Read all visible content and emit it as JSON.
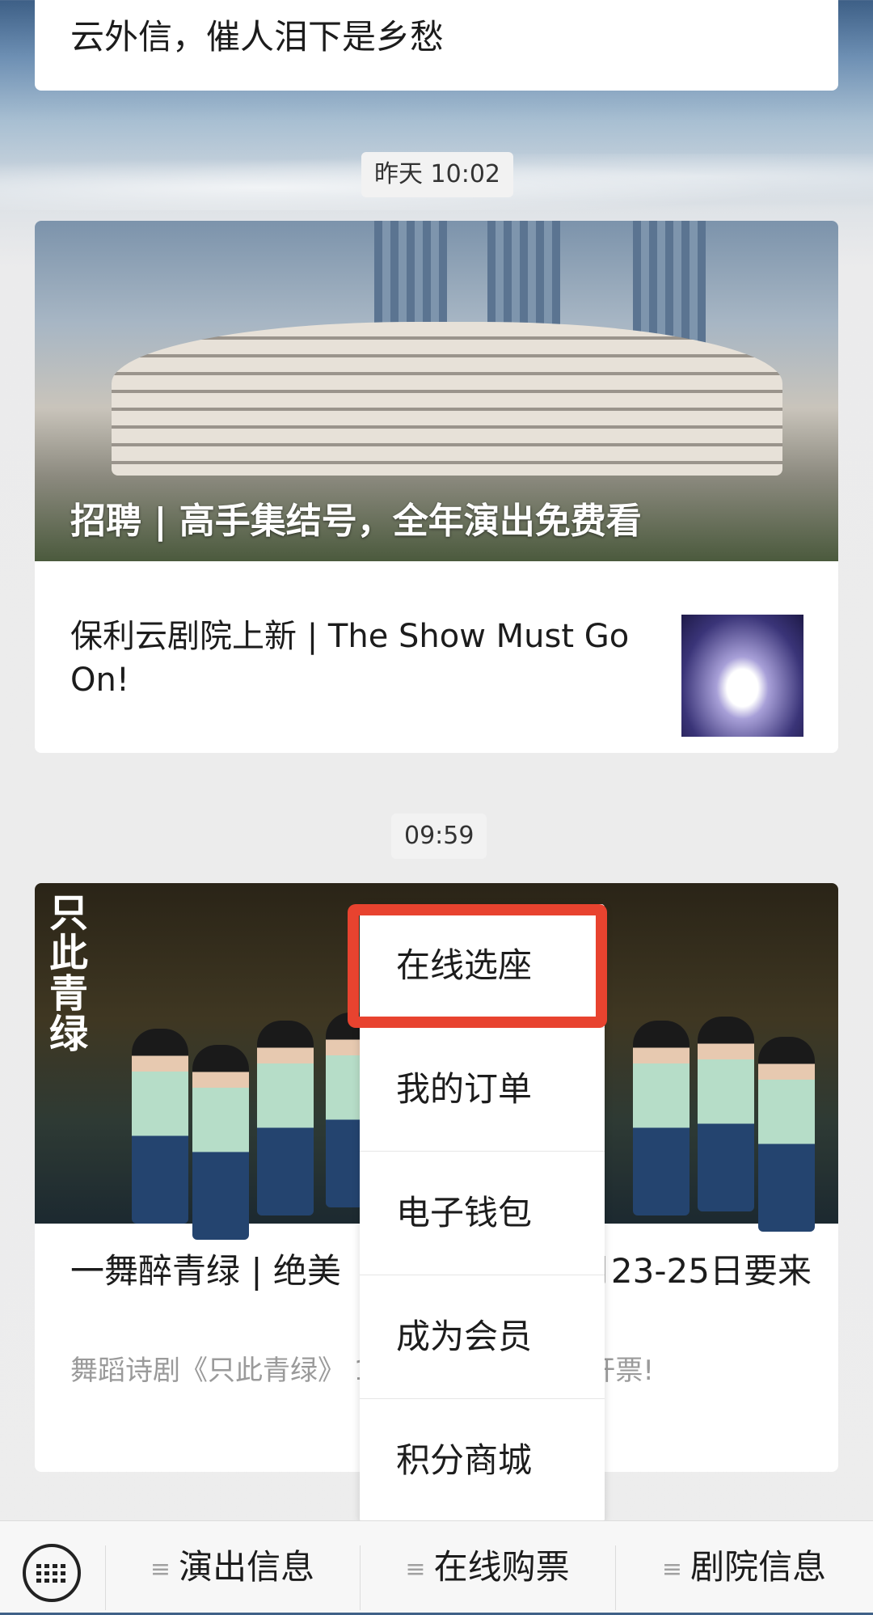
{
  "messages": {
    "top_card_text": "云外信，催人泪下是乡愁",
    "time_1": "昨天 10:02",
    "article_group_1": {
      "cover_title": "招聘 | 高手集结号，全年演出免费看",
      "item_title": "保利云剧院上新 | The Show Must Go On!"
    },
    "time_2": "09:59",
    "article_group_2": {
      "cover_calligraphy": "只此青绿",
      "title": "一舞醉青绿 | 绝美 《只此青绿》3月23-25日要来",
      "desc": "舞蹈诗剧《只此青绿》 1日（周一）10:58开票!"
    }
  },
  "popup_menu": {
    "items": [
      "在线选座",
      "我的订单",
      "电子钱包",
      "成为会员",
      "积分商城"
    ],
    "highlighted": "在线选座"
  },
  "bottom_bar": {
    "keyboard_icon": "keyboard-icon",
    "tabs": [
      "演出信息",
      "在线购票",
      "剧院信息"
    ],
    "tab_icon": "≡"
  },
  "colors": {
    "highlight": "#e8432f",
    "background": "#ededed"
  }
}
